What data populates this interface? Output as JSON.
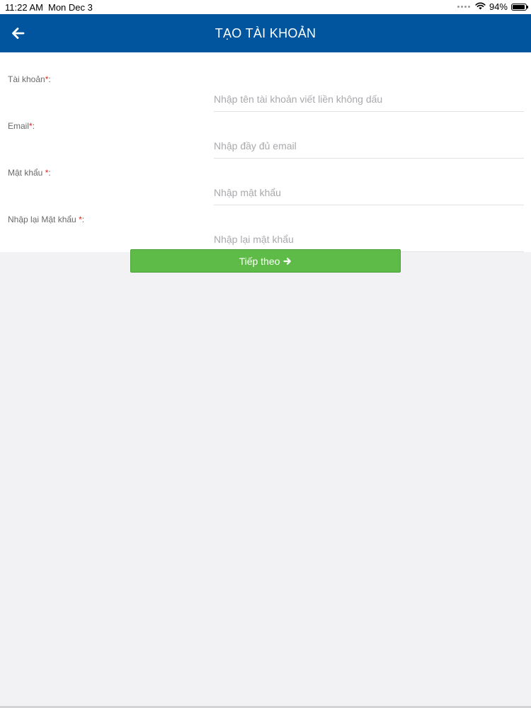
{
  "status_bar": {
    "time": "11:22 AM",
    "date": "Mon Dec 3",
    "battery_percent": "94%",
    "battery_level": 0.94
  },
  "nav": {
    "title": "TẠO TÀI KHOẢN",
    "back_icon": "arrow-left-icon"
  },
  "form": {
    "fields": [
      {
        "label": "Tài khoản",
        "required_mark": "*",
        "suffix": ":",
        "placeholder": "Nhập tên tài khoản viết liền không dấu",
        "value": ""
      },
      {
        "label": "Email",
        "required_mark": "*",
        "suffix": ":",
        "placeholder": "Nhập đầy đủ email",
        "value": ""
      },
      {
        "label": "Mật khẩu ",
        "required_mark": "*",
        "suffix": ":",
        "placeholder": "Nhập mật khẩu",
        "value": ""
      },
      {
        "label": "Nhập lại Mật khẩu ",
        "required_mark": "*",
        "suffix": ":",
        "placeholder": "Nhập lại mật khẩu",
        "value": ""
      }
    ]
  },
  "next_button": {
    "label": "Tiếp theo",
    "icon": "arrow-right-icon"
  },
  "colors": {
    "nav_background": "#00559e",
    "button_background": "#5fbb47",
    "required": "#e0241b"
  }
}
